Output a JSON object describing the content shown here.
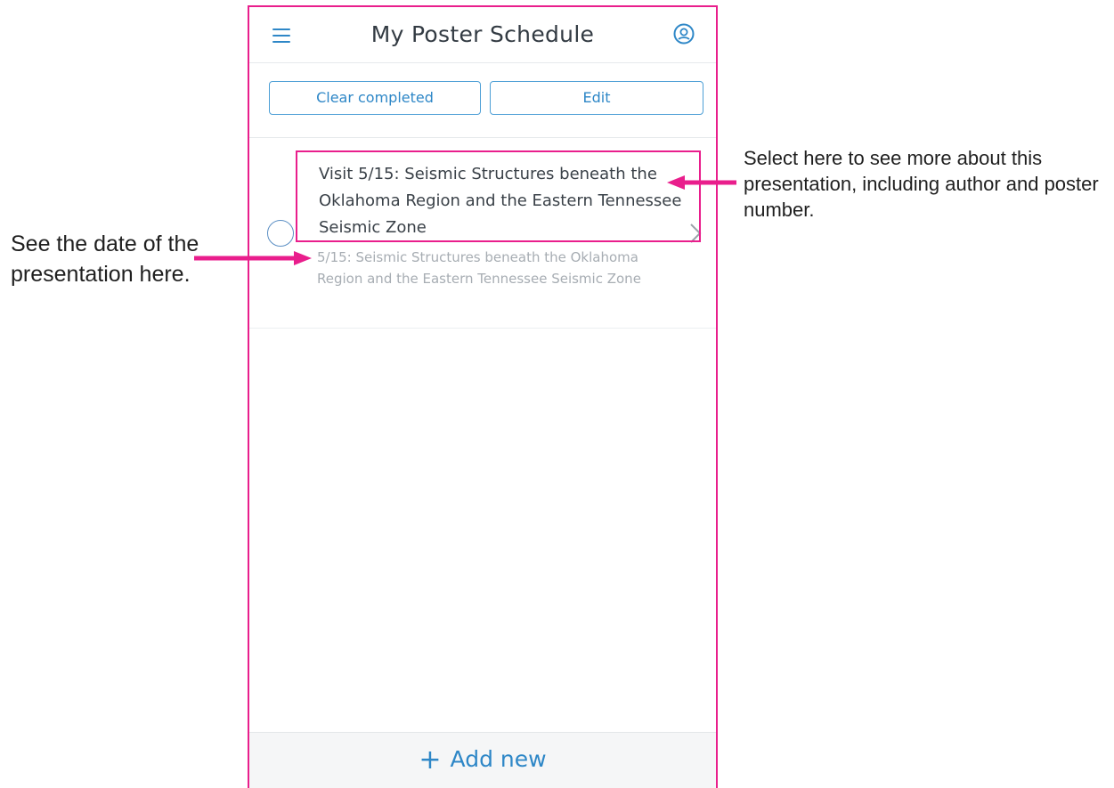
{
  "header": {
    "title": "My Poster Schedule",
    "menu_icon": "hamburger-menu-icon",
    "profile_icon": "user-circle-icon"
  },
  "toolbar": {
    "clear_label": "Clear completed",
    "edit_label": "Edit"
  },
  "items": [
    {
      "title": "Visit 5/15: Seismic Structures beneath the Oklahoma Region  and the Eastern Tennessee Seismic Zone",
      "subtitle": "5/15: Seismic Structures beneath the Oklahoma Region  and the Eastern Tennessee Seismic Zone",
      "completed": false
    }
  ],
  "footer": {
    "add_label": "Add new",
    "add_icon": "plus-icon"
  },
  "annotations": {
    "left": "See the date of the presentation here.",
    "right": "Select here to see more about this presentation, including author and poster number."
  },
  "colors": {
    "accent": "#2e87c7",
    "annotation": "#e91e8c",
    "title_text": "#333b43",
    "subtitle_text": "#a7adb3"
  }
}
